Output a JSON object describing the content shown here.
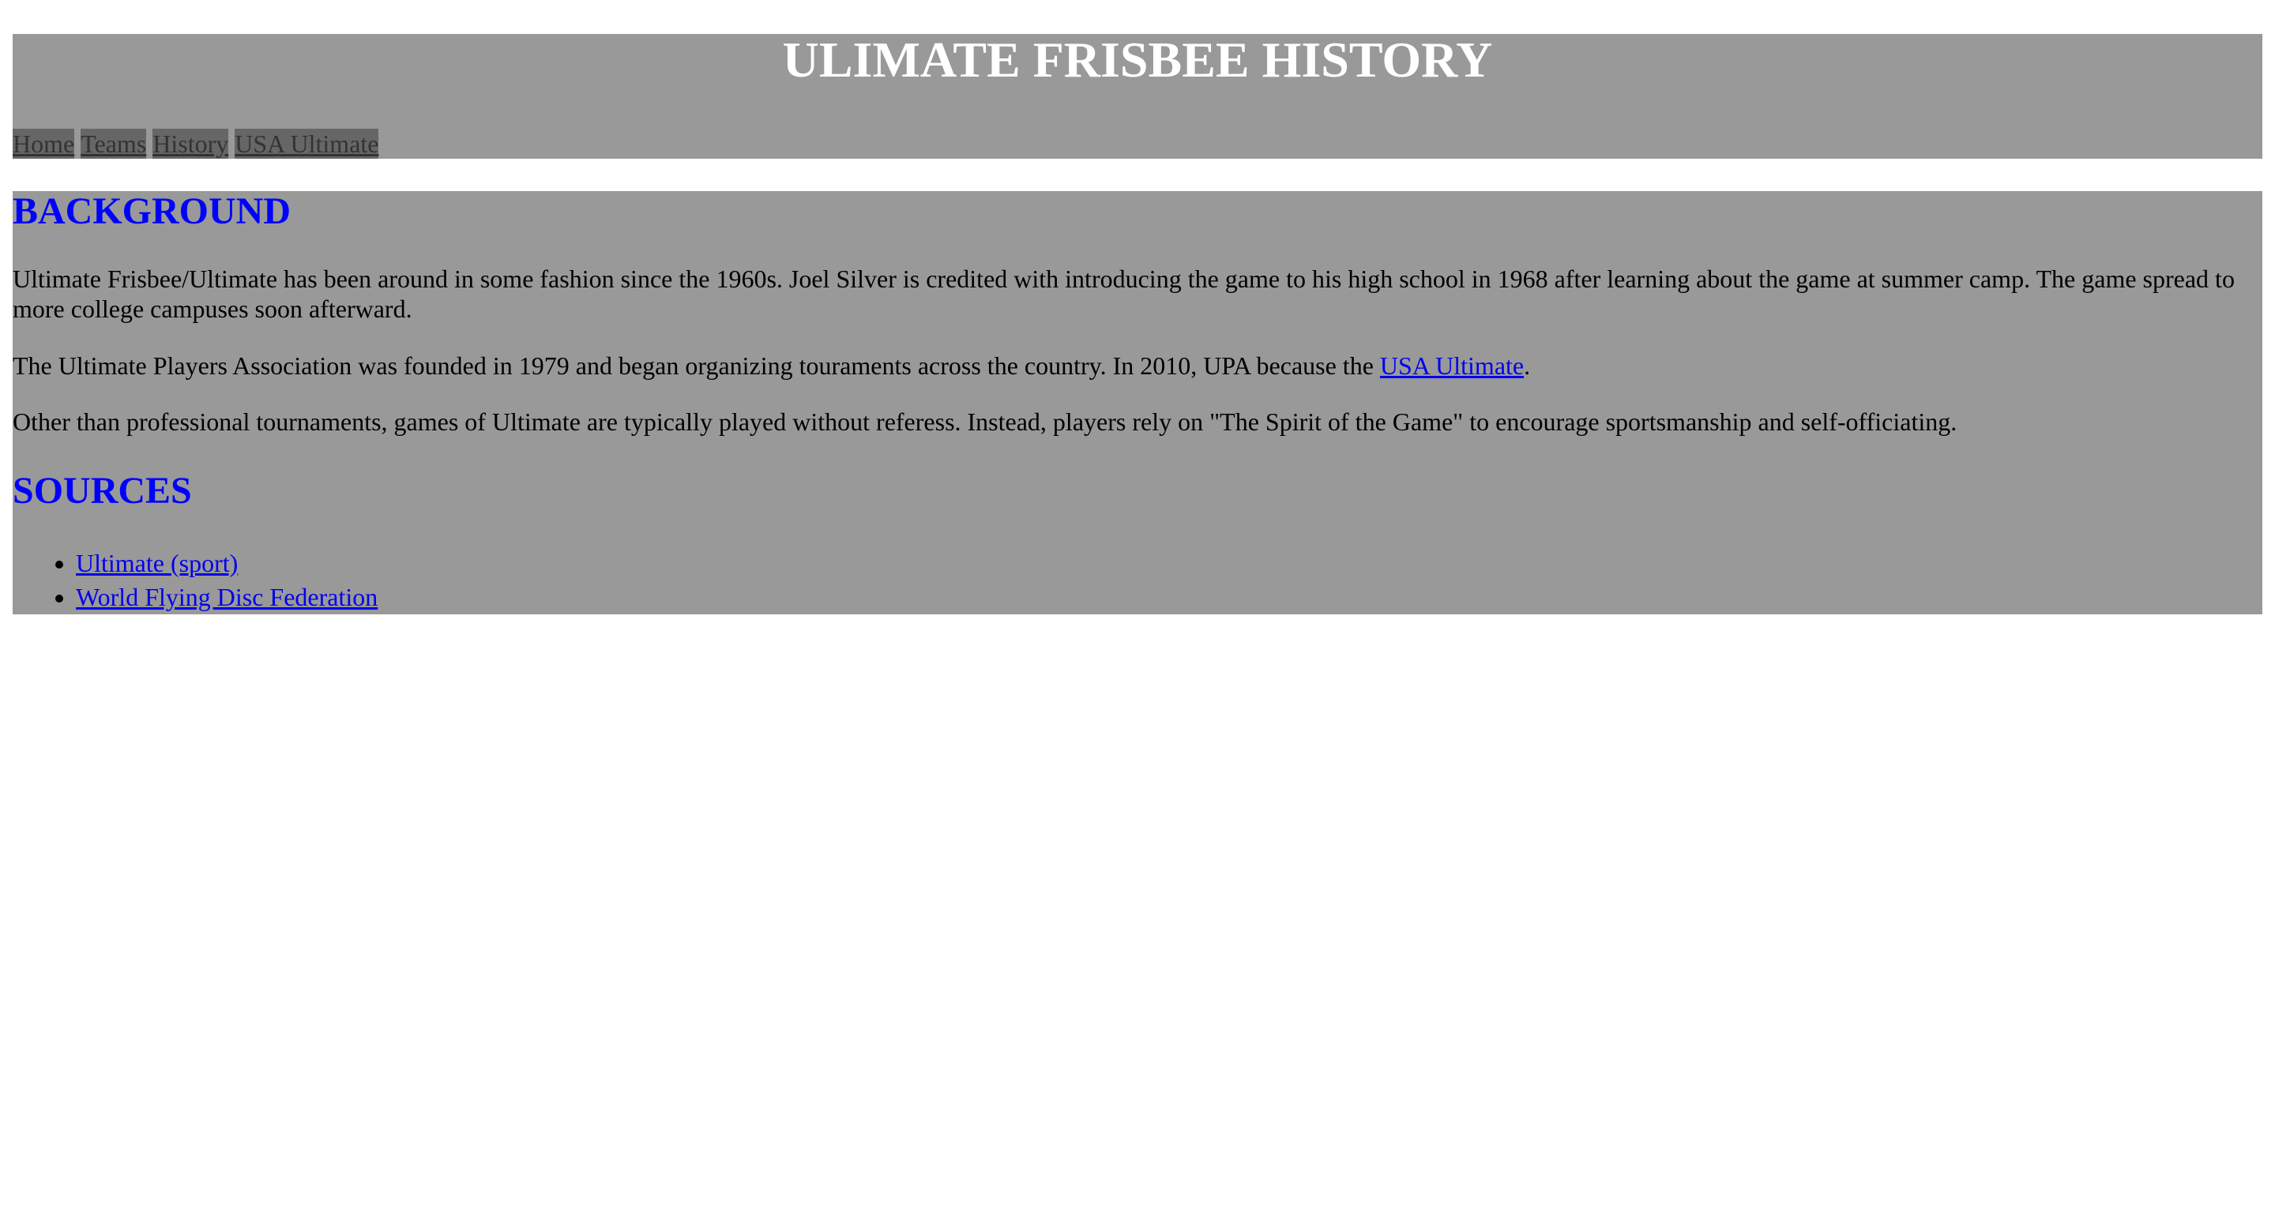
{
  "header": {
    "title": "ULIMATE FRISBEE HISTORY",
    "nav": [
      "Home",
      "Teams",
      "History",
      "USA Ultimate"
    ]
  },
  "background": {
    "heading": "BACKGROUND",
    "p1": "Ultimate Frisbee/Ultimate has been around in some fashion since the 1960s. Joel Silver is credited with introducing the game to his high school in 1968 after learning about the game at summer camp. The game spread to more college campuses soon afterward.",
    "p2_before": "The Ultimate Players Association was founded in 1979 and began organizing touraments across the country. In 2010, UPA because the ",
    "p2_link": "USA Ultimate",
    "p2_after": ".",
    "p3": "Other than professional tournaments, games of Ultimate are typically played without referess. Instead, players rely on \"The Spirit of the Game\" to encourage sportsmanship and self-officiating."
  },
  "sources": {
    "heading": "SOURCES",
    "links": [
      "Ultimate (sport)",
      "World Flying Disc Federation"
    ]
  },
  "colors": {
    "panel": "#999999",
    "nav_button": "#666666",
    "heading": "#0000ff",
    "link": "#0000ee"
  }
}
